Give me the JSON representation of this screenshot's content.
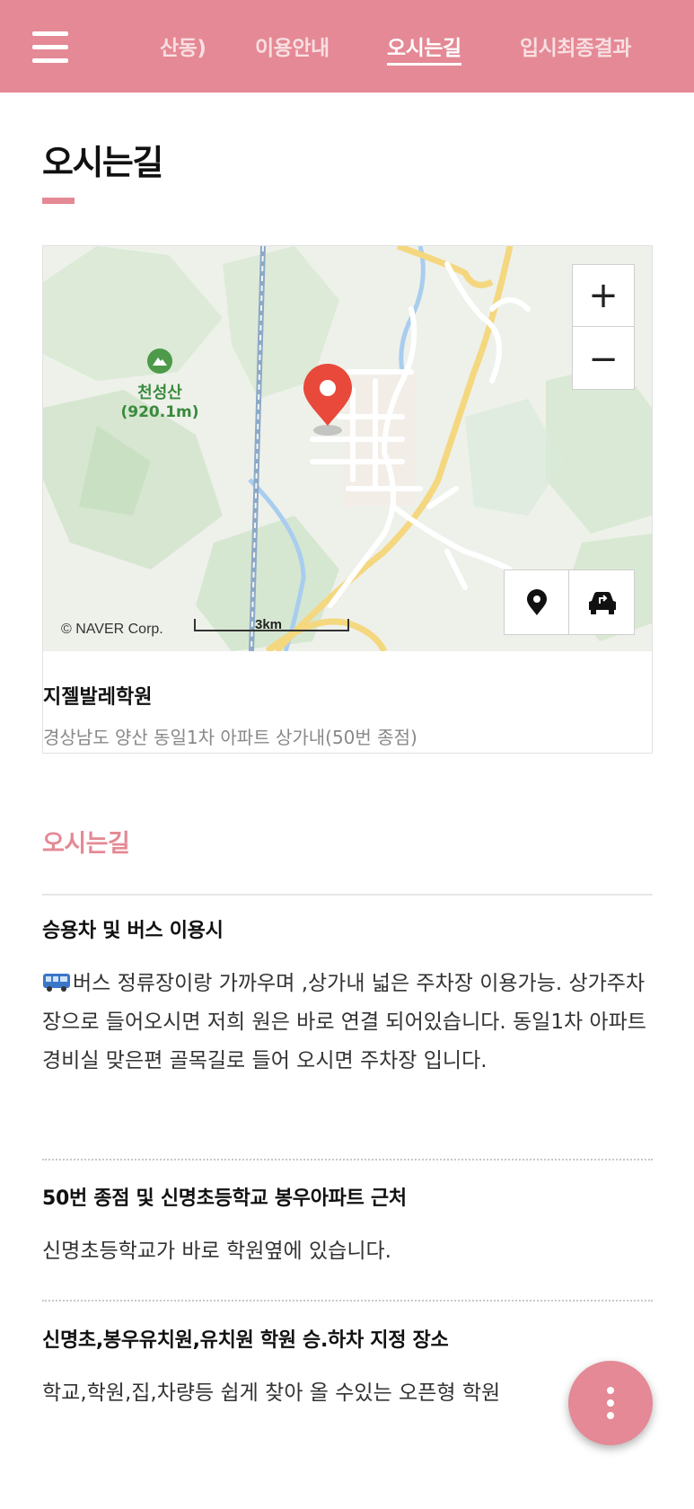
{
  "header": {
    "nav_tabs": [
      {
        "label": "산동)",
        "active": false
      },
      {
        "label": "이용안내",
        "active": false
      },
      {
        "label": "오시는길",
        "active": true
      },
      {
        "label": "입시최종결과",
        "active": false
      }
    ],
    "menu_icon": "hamburger-icon",
    "background_color": "#e48995"
  },
  "page": {
    "title": "오시는길"
  },
  "map": {
    "mountain_name": "천성산",
    "mountain_altitude": "(920.1m)",
    "copyright": "© NAVER Corp.",
    "scale_label": "3km",
    "zoom_in_label": "+",
    "zoom_out_label": "−",
    "tools": [
      "location-pin-icon",
      "car-icon"
    ],
    "place_name": "지젤발레학원",
    "place_address": "경상남도 양산 동일1차 아파트 상가내(50번 종점)"
  },
  "directions": {
    "section_title": "오시는길",
    "blocks": [
      {
        "title": "승용차 및 버스 이용시",
        "text": "버스 정류장이랑 가까우며 ,상가내 넓은 주차장 이용가능. 상가주차장으로 들어오시면 저희 원은 바로 연결 되어있습니다. 동일1차 아파트  경비실 맞은편 골목길로 들어 오시면 주차장 입니다."
      },
      {
        "title": "50번 종점 및 신명초등학교 봉우아파트 근처",
        "text": "신명초등학교가 바로 학원옆에 있습니다."
      },
      {
        "title": "신명초,봉우유치원,유치원 학원 승.하차 지정 장소",
        "text": "학교,학원,집,차량등 쉽게 찾아 올 수있는 오픈형 학원"
      }
    ]
  },
  "fab": {
    "icon": "more-vertical-icon"
  }
}
